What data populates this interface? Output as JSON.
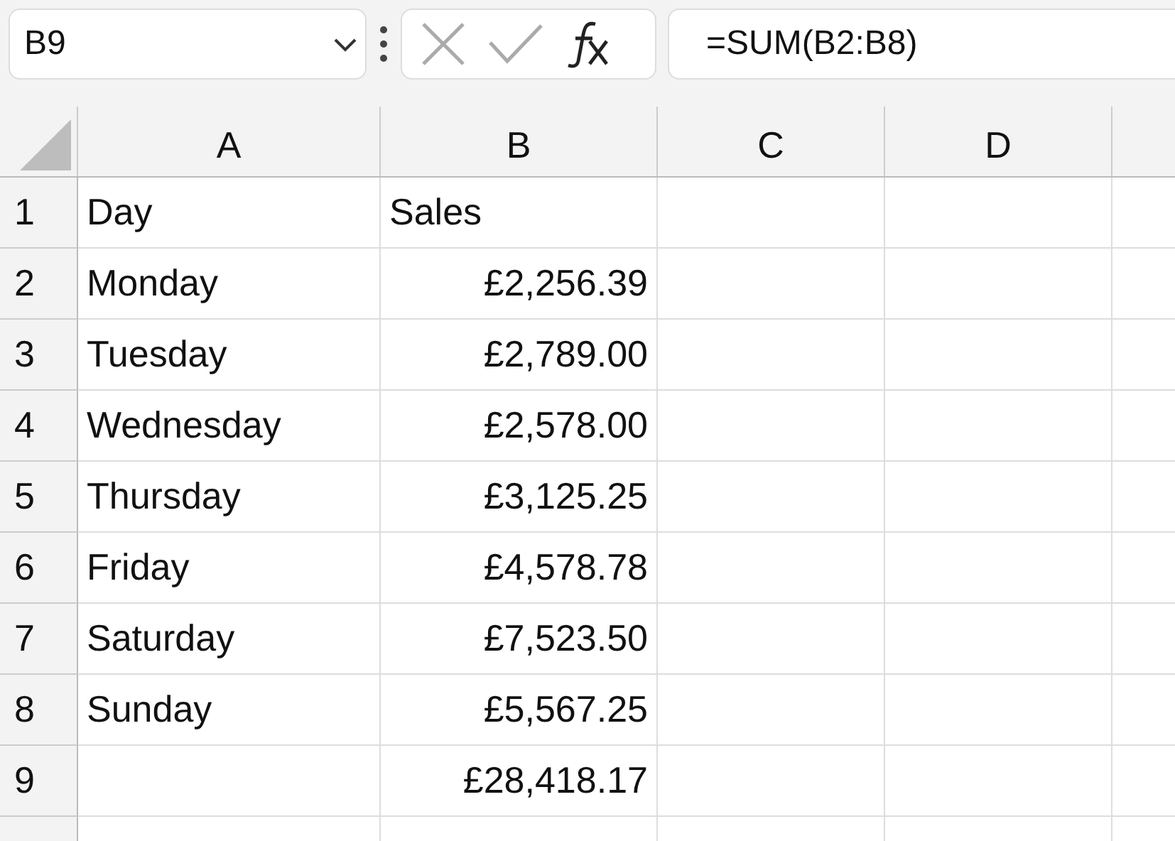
{
  "name_box": {
    "value": "B9"
  },
  "formula_bar": {
    "value": "=SUM(B2:B8)"
  },
  "columns": [
    "A",
    "B",
    "C",
    "D"
  ],
  "rows": [
    {
      "number": "1",
      "cells": [
        {
          "kind": "text",
          "value": "Day"
        },
        {
          "kind": "text",
          "value": "Sales"
        }
      ]
    },
    {
      "number": "2",
      "cells": [
        {
          "kind": "text",
          "value": "Monday"
        },
        {
          "kind": "number",
          "value": "£2,256.39"
        }
      ]
    },
    {
      "number": "3",
      "cells": [
        {
          "kind": "text",
          "value": "Tuesday"
        },
        {
          "kind": "number",
          "value": "£2,789.00"
        }
      ]
    },
    {
      "number": "4",
      "cells": [
        {
          "kind": "text",
          "value": "Wednesday"
        },
        {
          "kind": "number",
          "value": "£2,578.00"
        }
      ]
    },
    {
      "number": "5",
      "cells": [
        {
          "kind": "text",
          "value": "Thursday"
        },
        {
          "kind": "number",
          "value": "£3,125.25"
        }
      ]
    },
    {
      "number": "6",
      "cells": [
        {
          "kind": "text",
          "value": "Friday"
        },
        {
          "kind": "number",
          "value": "£4,578.78"
        }
      ]
    },
    {
      "number": "7",
      "cells": [
        {
          "kind": "text",
          "value": "Saturday"
        },
        {
          "kind": "number",
          "value": "£7,523.50"
        }
      ]
    },
    {
      "number": "8",
      "cells": [
        {
          "kind": "text",
          "value": "Sunday"
        },
        {
          "kind": "number",
          "value": "£5,567.25"
        }
      ]
    },
    {
      "number": "9",
      "cells": [
        {
          "kind": "empty"
        },
        {
          "kind": "number",
          "value": "£28,418.17"
        }
      ]
    }
  ]
}
